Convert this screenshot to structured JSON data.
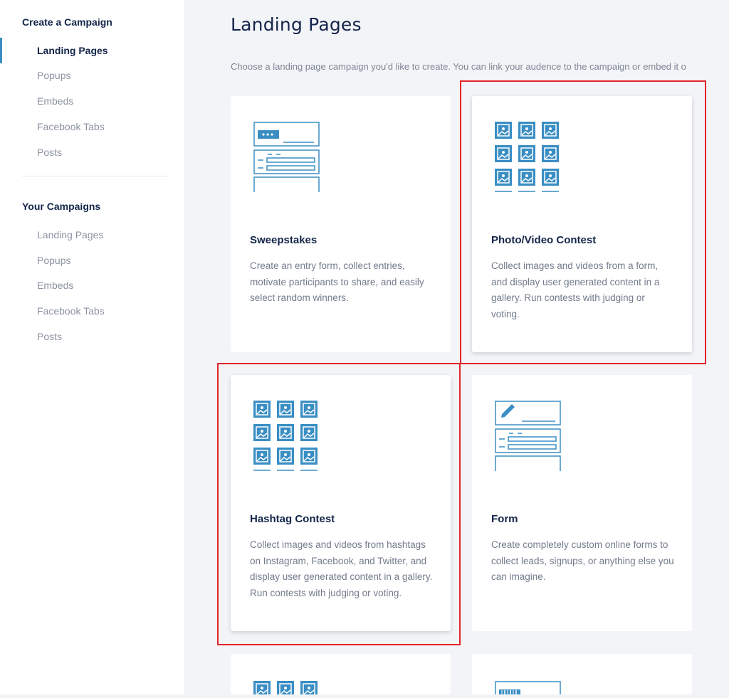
{
  "sidebar": {
    "create_title": "Create a Campaign",
    "create_items": [
      "Landing Pages",
      "Popups",
      "Embeds",
      "Facebook Tabs",
      "Posts"
    ],
    "your_title": "Your Campaigns",
    "your_items": [
      "Landing Pages",
      "Popups",
      "Embeds",
      "Facebook Tabs",
      "Posts"
    ]
  },
  "main": {
    "title": "Landing Pages",
    "description": "Choose a landing page campaign you'd like to create. You can link your audence to the campaign or embed it o"
  },
  "cards": [
    {
      "icon": "sweepstakes-ticket-form-icon",
      "title": "Sweepstakes",
      "description": "Create an entry form, collect entries, motivate participants to share, and easily select random winners."
    },
    {
      "icon": "photo-grid-icon",
      "title": "Photo/Video Contest",
      "description": "Collect images and videos from a form, and display user generated content in a gallery. Run contests with judging or voting."
    },
    {
      "icon": "photo-grid-icon",
      "title": "Hashtag Contest",
      "description": "Collect images and videos from hashtags on Instagram, Facebook, and Twitter, and display user generated content in a gallery. Run contests with judging or voting."
    },
    {
      "icon": "form-pencil-icon",
      "title": "Form",
      "description": "Create completely custom online forms to collect leads, signups, or anything else you can imagine."
    },
    {
      "icon": "photo-grid-icon"
    },
    {
      "icon": "barcode-form-icon"
    }
  ],
  "colors": {
    "accent": "#3a8ec4",
    "highlight": "#e3242b"
  }
}
